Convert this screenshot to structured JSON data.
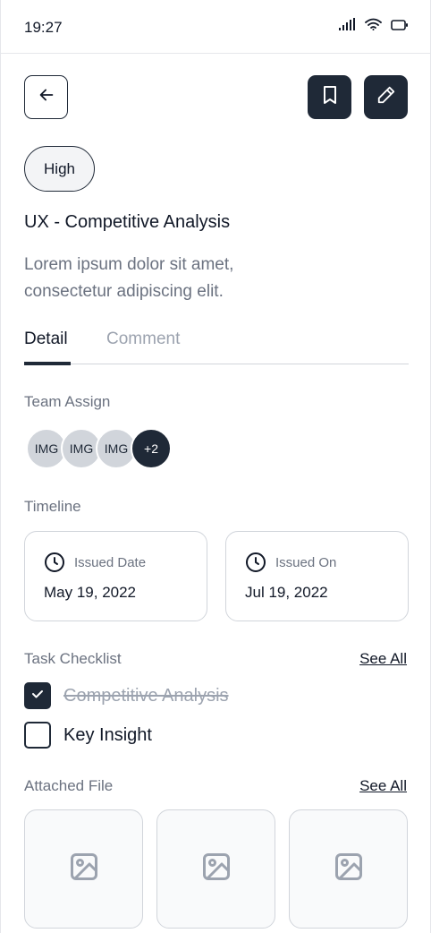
{
  "status_bar": {
    "time": "19:27",
    "icons": [
      "signal-icon",
      "wifi-icon",
      "battery-icon"
    ]
  },
  "header": {
    "back_icon": "arrow-left-icon",
    "bookmark_icon": "bookmark-icon",
    "edit_icon": "pencil-icon"
  },
  "task": {
    "priority": "High",
    "title": "UX - Competitive Analysis",
    "description": "Lorem ipsum dolor sit amet, consectetur adipiscing elit."
  },
  "tabs": [
    {
      "label": "Detail",
      "active": true
    },
    {
      "label": "Comment",
      "active": false
    }
  ],
  "team": {
    "label": "Team Assign",
    "avatars": [
      "IMG",
      "IMG",
      "IMG"
    ],
    "more": "+2"
  },
  "timeline": {
    "label": "Timeline",
    "cards": [
      {
        "icon": "clock-icon",
        "label": "Issued Date",
        "value": "May 19, 2022"
      },
      {
        "icon": "clock-icon",
        "label": "Issued On",
        "value": "Jul 19, 2022"
      }
    ]
  },
  "checklist": {
    "label": "Task Checklist",
    "see_all": "See All",
    "items": [
      {
        "label": "Competitive Analysis",
        "checked": true
      },
      {
        "label": "Key Insight",
        "checked": false
      }
    ]
  },
  "files": {
    "label": "Attached File",
    "see_all": "See All",
    "items": [
      "image-icon",
      "image-icon",
      "image-icon"
    ]
  },
  "colors": {
    "primary": "#1f2937",
    "muted_text": "#6b7280",
    "border": "#d1d5db"
  }
}
